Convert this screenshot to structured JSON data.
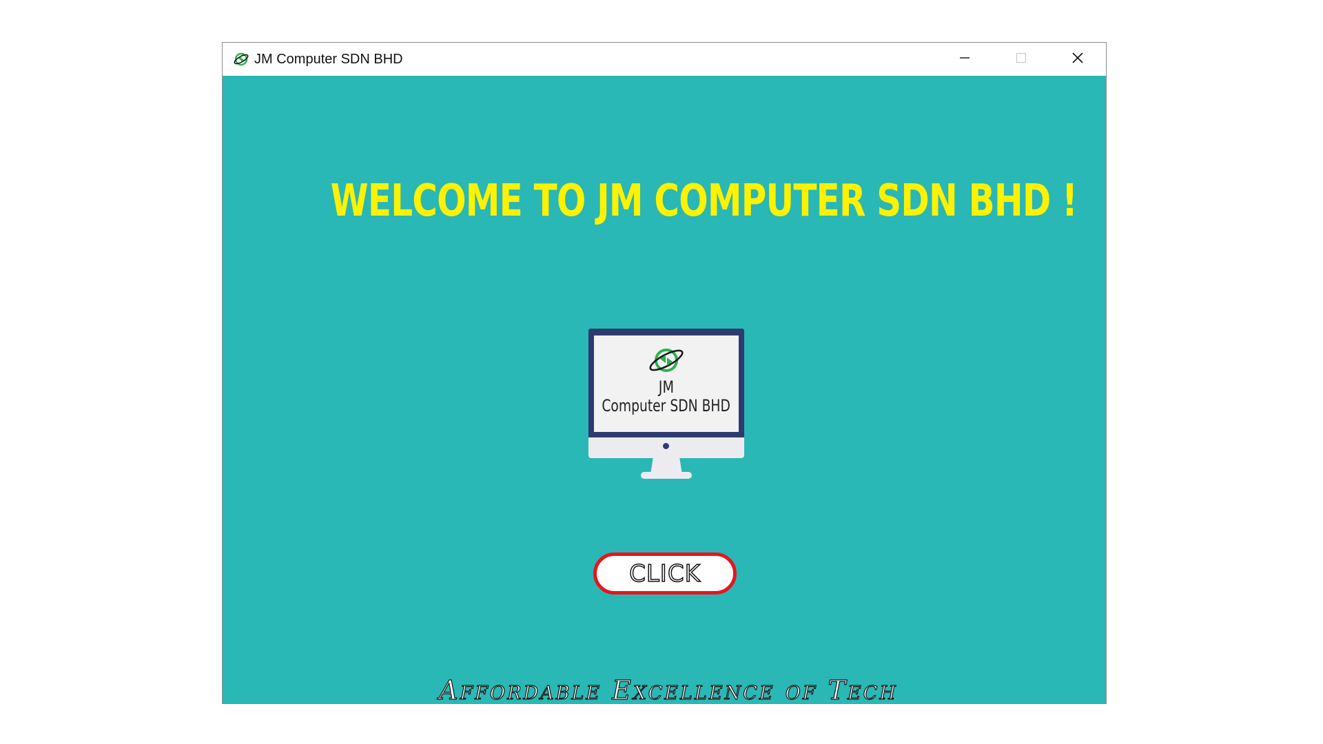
{
  "window": {
    "title": "JM Computer SDN BHD",
    "icon": "globe-refresh-icon",
    "controls": {
      "minimize_icon": "minimize-icon",
      "maximize_icon": "maximize-icon",
      "close_icon": "close-icon"
    }
  },
  "main": {
    "welcome_text": "WELCOME TO JM COMPUTER SDN BHD !",
    "monitor": {
      "logo_icon": "globe-refresh-icon",
      "line1": "JM",
      "line2": "Computer SDN BHD"
    },
    "click_button_label": "CLICK",
    "tagline": "Affordable Excellence of Tech"
  },
  "colors": {
    "background": "#29b8b5",
    "welcome_text": "#fff200",
    "button_border": "#e8141c",
    "monitor_frame": "#2e3b6e",
    "logo_green": "#2bb24c"
  }
}
